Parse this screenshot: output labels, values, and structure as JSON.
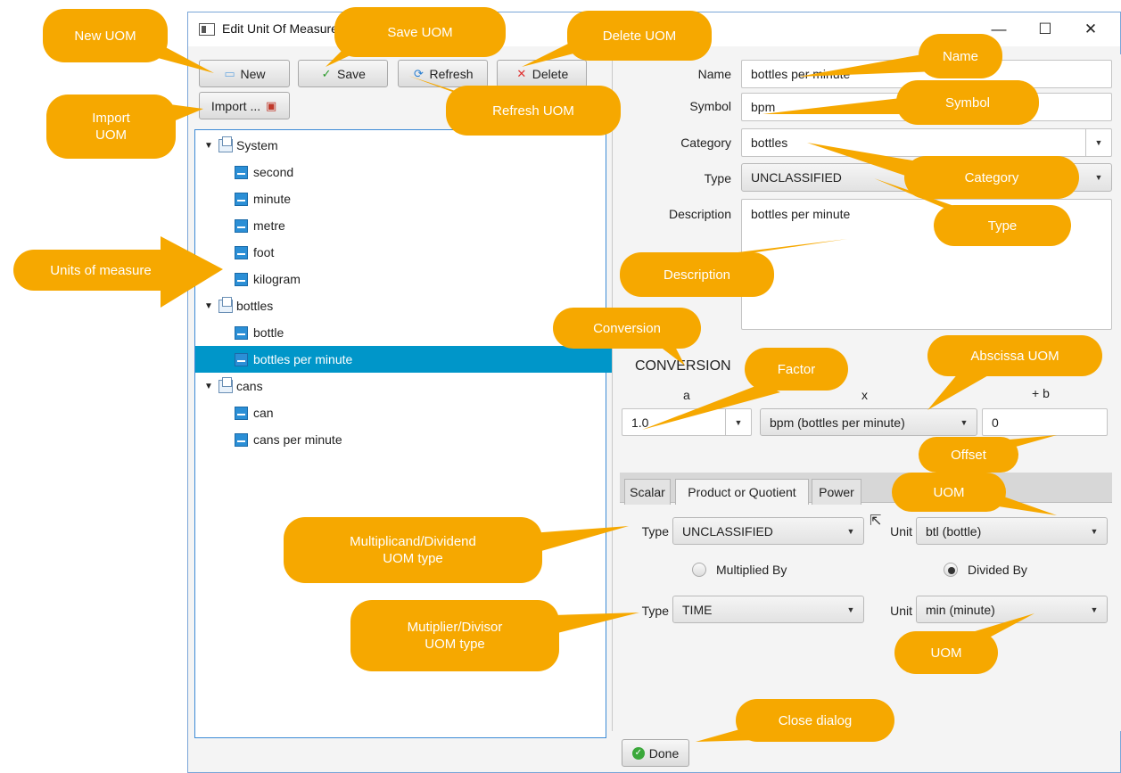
{
  "window": {
    "title": "Edit Unit Of Measure",
    "controls": {
      "minimize": "—",
      "maximize": "☐",
      "close": "✕"
    }
  },
  "toolbar": {
    "new_label": "New",
    "save_label": "Save",
    "refresh_label": "Refresh",
    "delete_label": "Delete",
    "import_label": "Import ..."
  },
  "tree": [
    {
      "label": "System",
      "kind": "category"
    },
    {
      "label": "second",
      "kind": "unit"
    },
    {
      "label": "minute",
      "kind": "unit"
    },
    {
      "label": "metre",
      "kind": "unit"
    },
    {
      "label": "foot",
      "kind": "unit"
    },
    {
      "label": "kilogram",
      "kind": "unit"
    },
    {
      "label": "bottles",
      "kind": "category"
    },
    {
      "label": "bottle",
      "kind": "unit"
    },
    {
      "label": "bottles per minute",
      "kind": "unit",
      "selected": true
    },
    {
      "label": "cans",
      "kind": "category"
    },
    {
      "label": "can",
      "kind": "unit"
    },
    {
      "label": "cans per minute",
      "kind": "unit"
    }
  ],
  "form": {
    "name_label": "Name",
    "name_value": "bottles per minute",
    "symbol_label": "Symbol",
    "symbol_value": "bpm",
    "category_label": "Category",
    "category_value": "bottles",
    "type_label": "Type",
    "type_value": "UNCLASSIFIED",
    "description_label": "Description",
    "description_value": "bottles per minute"
  },
  "conversion": {
    "heading": "CONVERSION",
    "a_label": "a",
    "x_label": "x",
    "b_label": "+ b",
    "factor_value": "1.0",
    "abscissa_value": "bpm (bottles per minute)",
    "offset_value": "0"
  },
  "tabs": [
    {
      "label": "Scalar"
    },
    {
      "label": "Product or Quotient",
      "active": true
    },
    {
      "label": "Power"
    }
  ],
  "product": {
    "type1_label": "Type",
    "type1_value": "UNCLASSIFIED",
    "unit1_label": "Unit",
    "unit1_value": "btl (bottle)",
    "multiplied_label": "Multiplied By",
    "divided_label": "Divided By",
    "selected_operation": "Divided By",
    "type2_label": "Type",
    "type2_value": "TIME",
    "unit2_label": "Unit",
    "unit2_value": "min (minute)"
  },
  "done_label": "Done",
  "callouts": {
    "new_uom": "New UOM",
    "save_uom": "Save UOM",
    "delete_uom": "Delete UOM",
    "import_uom": "Import\nUOM",
    "refresh_uom": "Refresh UOM",
    "name": "Name",
    "symbol": "Symbol",
    "category": "Category",
    "type": "Type",
    "description": "Description",
    "units_of_measure": "Units of measure",
    "conversion": "Conversion",
    "factor": "Factor",
    "abscissa_uom": "Abscissa UOM",
    "offset": "Offset",
    "uom_top": "UOM",
    "multiplicand": "Multiplicand/Dividend\nUOM type",
    "multiplier": "Mutiplier/Divisor\nUOM type",
    "uom_bottom": "UOM",
    "close_dialog": "Close dialog"
  },
  "colors": {
    "callout": "#f6a800",
    "selection": "#0096c9",
    "border_accent": "#3d8bd6"
  }
}
